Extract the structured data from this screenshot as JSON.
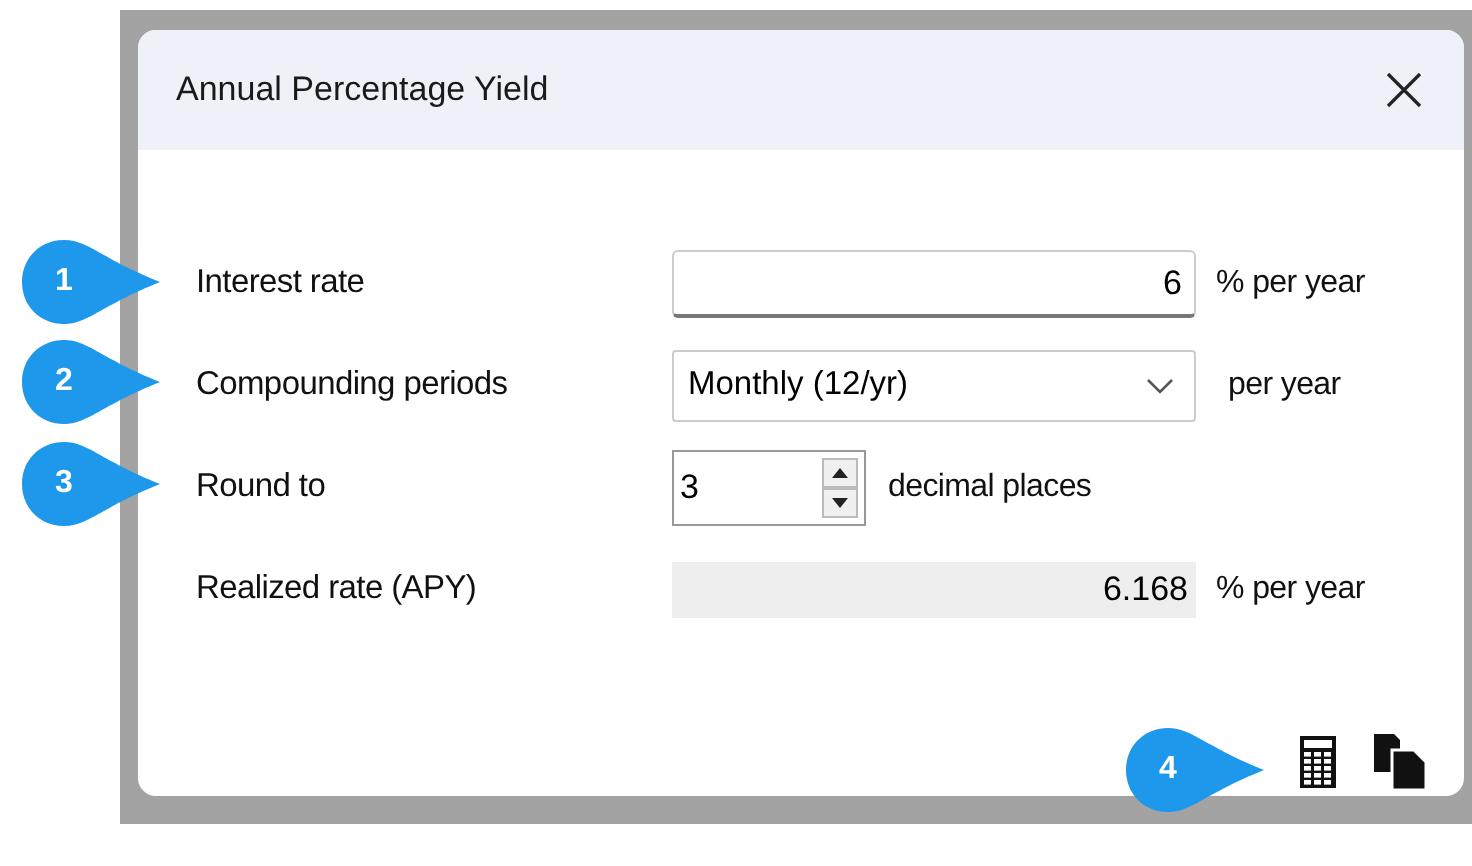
{
  "window": {
    "title": "Annual Percentage Yield"
  },
  "rows": [
    {
      "kind": "input",
      "label": "Interest rate",
      "value": "6",
      "unit": "% per year"
    },
    {
      "kind": "dropdown",
      "label": "Compounding periods",
      "value": "Monthly (12/yr)",
      "unit": "per year"
    },
    {
      "kind": "spinner",
      "label": "Round to",
      "value": "3",
      "unit": "decimal places"
    },
    {
      "kind": "readout",
      "label": "Realized rate (APY)",
      "value": "6.168",
      "unit": "% per year"
    }
  ],
  "callouts": [
    "1",
    "2",
    "3",
    "4"
  ]
}
